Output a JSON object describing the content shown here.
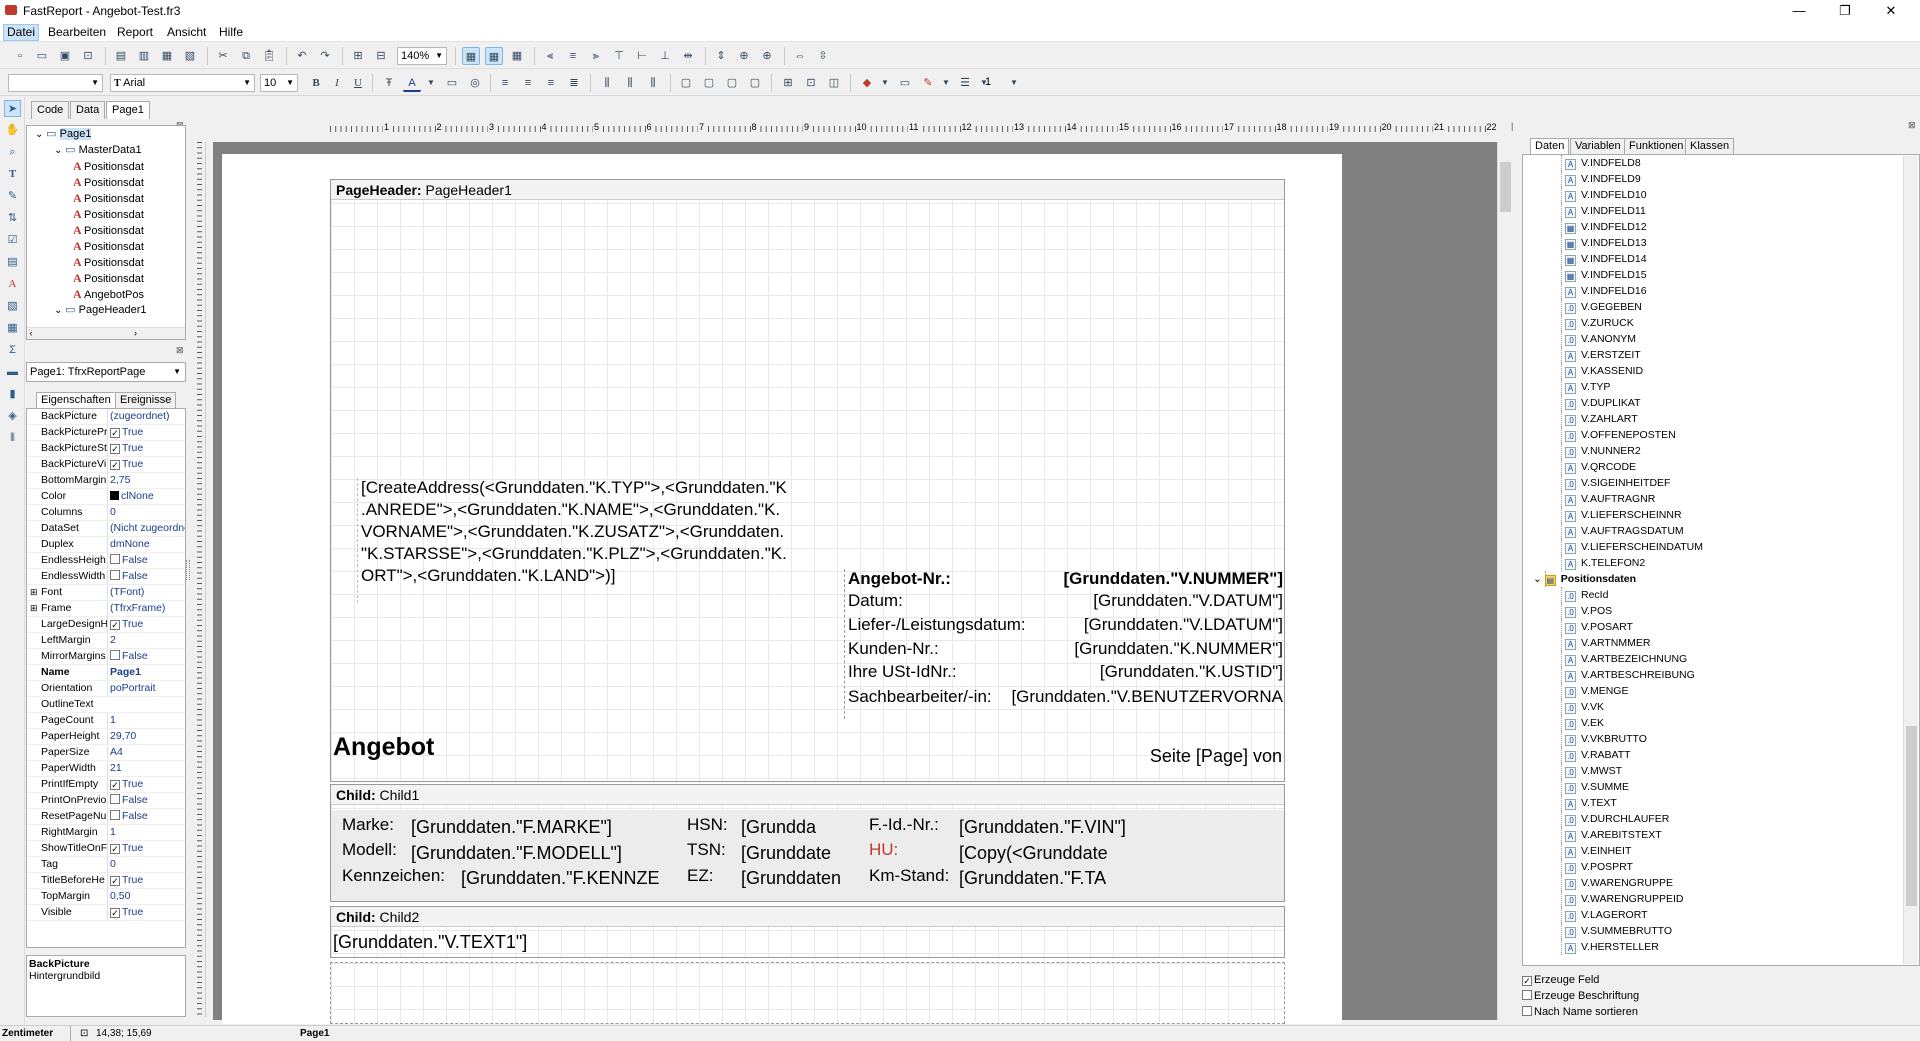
{
  "window": {
    "title": "FastReport - Angebot-Test.fr3",
    "minimize": "—",
    "maximize": "❐",
    "close": "✕"
  },
  "menu": [
    "Datei",
    "Bearbeiten",
    "Report",
    "Ansicht",
    "Hilfe"
  ],
  "toolbar": {
    "zoom": "140%",
    "font_name": "Arial",
    "font_size": "10",
    "frame_width": "1",
    "style_combo": ""
  },
  "tabs": [
    "Code",
    "Data",
    "Page1"
  ],
  "tree": {
    "items": [
      {
        "label": "Page1",
        "level": 0,
        "icon": "page"
      },
      {
        "label": "MasterData1",
        "level": 1,
        "icon": "band"
      },
      {
        "label": "Positionsdat",
        "level": 2,
        "icon": "text"
      },
      {
        "label": "Positionsdat",
        "level": 2,
        "icon": "text"
      },
      {
        "label": "Positionsdat",
        "level": 2,
        "icon": "text"
      },
      {
        "label": "Positionsdat",
        "level": 2,
        "icon": "text"
      },
      {
        "label": "Positionsdat",
        "level": 2,
        "icon": "text"
      },
      {
        "label": "Positionsdat",
        "level": 2,
        "icon": "text"
      },
      {
        "label": "Positionsdat",
        "level": 2,
        "icon": "text"
      },
      {
        "label": "Positionsdat",
        "level": 2,
        "icon": "text"
      },
      {
        "label": "AngebotPos",
        "level": 2,
        "icon": "text"
      },
      {
        "label": "PageHeader1",
        "level": 1,
        "icon": "band"
      }
    ]
  },
  "page_combo": "Page1: TfrxReportPage",
  "prop_tabs": [
    "Eigenschaften",
    "Ereignisse"
  ],
  "properties": [
    {
      "name": "BackPicture",
      "value": "(zugeordnet)",
      "check": null
    },
    {
      "name": "BackPicturePr",
      "value": "True",
      "check": true
    },
    {
      "name": "BackPictureSt",
      "value": "True",
      "check": true
    },
    {
      "name": "BackPictureVi",
      "value": "True",
      "check": true
    },
    {
      "name": "BottomMargin",
      "value": "2,75",
      "check": null
    },
    {
      "name": "Color",
      "value": "clNone",
      "check": null
    },
    {
      "name": "Columns",
      "value": "0",
      "check": null
    },
    {
      "name": "DataSet",
      "value": "(Nicht zugeordnet)",
      "check": null
    },
    {
      "name": "Duplex",
      "value": "dmNone",
      "check": null
    },
    {
      "name": "EndlessHeigh",
      "value": "False",
      "check": false
    },
    {
      "name": "EndlessWidth",
      "value": "False",
      "check": false
    },
    {
      "name": "Font",
      "value": "(TFont)",
      "check": null
    },
    {
      "name": "Frame",
      "value": "(TfrxFrame)",
      "check": null
    },
    {
      "name": "LargeDesignH",
      "value": "True",
      "check": true
    },
    {
      "name": "LeftMargin",
      "value": "2",
      "check": null
    },
    {
      "name": "MirrorMargins",
      "value": "False",
      "check": false
    },
    {
      "name": "Name",
      "value": "Page1",
      "check": null
    },
    {
      "name": "Orientation",
      "value": "poPortrait",
      "check": null
    },
    {
      "name": "OutlineText",
      "value": "",
      "check": null
    },
    {
      "name": "PageCount",
      "value": "1",
      "check": null
    },
    {
      "name": "PaperHeight",
      "value": "29,70",
      "check": null
    },
    {
      "name": "PaperSize",
      "value": "A4",
      "check": null
    },
    {
      "name": "PaperWidth",
      "value": "21",
      "check": null
    },
    {
      "name": "PrintIfEmpty",
      "value": "True",
      "check": true
    },
    {
      "name": "PrintOnPrevio",
      "value": "False",
      "check": false
    },
    {
      "name": "ResetPageNu",
      "value": "False",
      "check": false
    },
    {
      "name": "RightMargin",
      "value": "1",
      "check": null
    },
    {
      "name": "ShowTitleOnF",
      "value": "True",
      "check": true
    },
    {
      "name": "Tag",
      "value": "0",
      "check": null
    },
    {
      "name": "TitleBeforeHe",
      "value": "True",
      "check": true
    },
    {
      "name": "TopMargin",
      "value": "0,50",
      "check": null
    },
    {
      "name": "Visible",
      "value": "True",
      "check": true
    }
  ],
  "prop_desc": {
    "title": "BackPicture",
    "text": "Hintergrundbild"
  },
  "ruler_numbers": [
    "1",
    "2",
    "3",
    "4",
    "5",
    "6",
    "7",
    "8",
    "9",
    "10",
    "11",
    "12",
    "13",
    "14",
    "15",
    "16",
    "17",
    "18",
    "19",
    "20",
    "21",
    "22"
  ],
  "report": {
    "pageheader": {
      "title_bold": "PageHeader:",
      "title_name": "PageHeader1"
    },
    "address": [
      "[CreateAddress(<Grunddaten.\"K.TYP\">,<Grunddaten.\"K",
      ".ANREDE\">,<Grunddaten.\"K.NAME\">,<Grunddaten.\"K.",
      "VORNAME\">,<Grunddaten.\"K.ZUSATZ\">,<Grunddaten.",
      "\"K.STARSSE\">,<Grunddaten.\"K.PLZ\">,<Grunddaten.\"K.",
      "ORT\">,<Grunddaten.\"K.LAND\">)]"
    ],
    "info_labels": [
      "Angebot-Nr.:",
      "Datum:",
      "Liefer-/Leistungsdatum:",
      "Kunden-Nr.:",
      "Ihre USt-IdNr.:",
      "Sachbearbeiter/-in:"
    ],
    "info_values": [
      "[Grunddaten.\"V.NUMMER\"]",
      "[Grunddaten.\"V.DATUM\"]",
      "[Grunddaten.\"V.LDATUM\"]",
      "[Grunddaten.\"K.NUMMER\"]",
      "[Grunddaten.\"K.USTID\"]",
      "[Grunddaten.\"V.BENUTZERVORNA"
    ],
    "angebot": "Angebot",
    "seite": "Seite [Page] von",
    "child1": {
      "title_bold": "Child:",
      "title_name": "Child1",
      "col1_labels": [
        "Marke:",
        "Modell:",
        "Kennzeichen:"
      ],
      "col1_values": [
        "[Grunddaten.\"F.MARKE\"]",
        "[Grunddaten.\"F.MODELL\"]",
        "[Grunddaten.\"F.KENNZE"
      ],
      "col2_labels": [
        "HSN:",
        "TSN:",
        "EZ:"
      ],
      "col2_values": [
        "[Grundda",
        "[Grunddate",
        "[Grunddaten"
      ],
      "col3_labels": [
        "F.-Id.-Nr.:",
        "HU:",
        "Km-Stand:"
      ],
      "col3_values": [
        "[Grunddaten.\"F.VIN\"]",
        "[Copy(<Grunddate",
        "[Grunddaten.\"F.TA"
      ]
    },
    "child2": {
      "title_bold": "Child:",
      "title_name": "Child2",
      "text": "[Grunddaten.\"V.TEXT1\"]"
    }
  },
  "right_tabs": [
    "Daten",
    "Variablen",
    "Funktionen",
    "Klassen"
  ],
  "data_tree": [
    {
      "label": "V.INDFELD8",
      "icon": "A"
    },
    {
      "label": "V.INDFELD9",
      "icon": "A"
    },
    {
      "label": "V.INDFELD10",
      "icon": "A"
    },
    {
      "label": "V.INDFELD11",
      "icon": "A"
    },
    {
      "label": "V.INDFELD12",
      "icon": "#"
    },
    {
      "label": "V.INDFELD13",
      "icon": "#"
    },
    {
      "label": "V.INDFELD14",
      "icon": "#"
    },
    {
      "label": "V.INDFELD15",
      "icon": "#"
    },
    {
      "label": "V.INDFELD16",
      "icon": "A"
    },
    {
      "label": "V.GEGEBEN",
      "icon": ".0"
    },
    {
      "label": "V.ZURUCK",
      "icon": ".0"
    },
    {
      "label": "V.ANONYM",
      "icon": ".0"
    },
    {
      "label": "V.ERSTZEIT",
      "icon": "A"
    },
    {
      "label": "V.KASSENID",
      "icon": "A"
    },
    {
      "label": "V.TYP",
      "icon": "A"
    },
    {
      "label": "V.DUPLIKAT",
      "icon": ".0"
    },
    {
      "label": "V.ZAHLART",
      "icon": ".0"
    },
    {
      "label": "V.OFFENEPOSTEN",
      "icon": ".0"
    },
    {
      "label": "V.NUNNER2",
      "icon": ".0"
    },
    {
      "label": "V.QRCODE",
      "icon": "A"
    },
    {
      "label": "V.SIGEINHEITDEF",
      "icon": ".0"
    },
    {
      "label": "V.AUFTRAGNR",
      "icon": "A"
    },
    {
      "label": "V.LIEFERSCHEINNR",
      "icon": "A"
    },
    {
      "label": "V.AUFTRAGSDATUM",
      "icon": "A"
    },
    {
      "label": "V.LIEFERSCHEINDATUM",
      "icon": "A"
    },
    {
      "label": "K.TELEFON2",
      "icon": "A"
    },
    {
      "label": "Positionsdaten",
      "icon": "db",
      "bold": true
    },
    {
      "label": "RecId",
      "icon": ".0"
    },
    {
      "label": "V.POS",
      "icon": ".0"
    },
    {
      "label": "V.POSART",
      "icon": ".0"
    },
    {
      "label": "V.ARTNMMER",
      "icon": "A"
    },
    {
      "label": "V.ARTBEZEICHNUNG",
      "icon": "A"
    },
    {
      "label": "V.ARTBESCHREIBUNG",
      "icon": "A"
    },
    {
      "label": "V.MENGE",
      "icon": ".0"
    },
    {
      "label": "V.VK",
      "icon": ".0"
    },
    {
      "label": "V.EK",
      "icon": ".0"
    },
    {
      "label": "V.VKBRUTTO",
      "icon": ".0"
    },
    {
      "label": "V.RABATT",
      "icon": ".0"
    },
    {
      "label": "V.MWST",
      "icon": ".0"
    },
    {
      "label": "V.SUMME",
      "icon": ".0"
    },
    {
      "label": "V.TEXT",
      "icon": "A"
    },
    {
      "label": "V.DURCHLAUFER",
      "icon": ".0"
    },
    {
      "label": "V.AREBITSTEXT",
      "icon": "A"
    },
    {
      "label": "V.EINHEIT",
      "icon": "A"
    },
    {
      "label": "V.POSPRT",
      "icon": ".0"
    },
    {
      "label": "V.WARENGRUPPE",
      "icon": ".0"
    },
    {
      "label": "V.WARENGRUPPEID",
      "icon": ".0"
    },
    {
      "label": "V.LAGERORT",
      "icon": ".0"
    },
    {
      "label": "V.SUMMEBRUTTO",
      "icon": ".0"
    },
    {
      "label": "V.HERSTELLER",
      "icon": "A"
    }
  ],
  "checkboxes": [
    {
      "label": "Erzeuge Feld",
      "checked": true
    },
    {
      "label": "Erzeuge Beschriftung",
      "checked": false
    },
    {
      "label": "Nach Name sortieren",
      "checked": false
    }
  ],
  "status": {
    "unit": "Zentimeter",
    "coords": "14,38; 15,69",
    "page": "Page1"
  }
}
